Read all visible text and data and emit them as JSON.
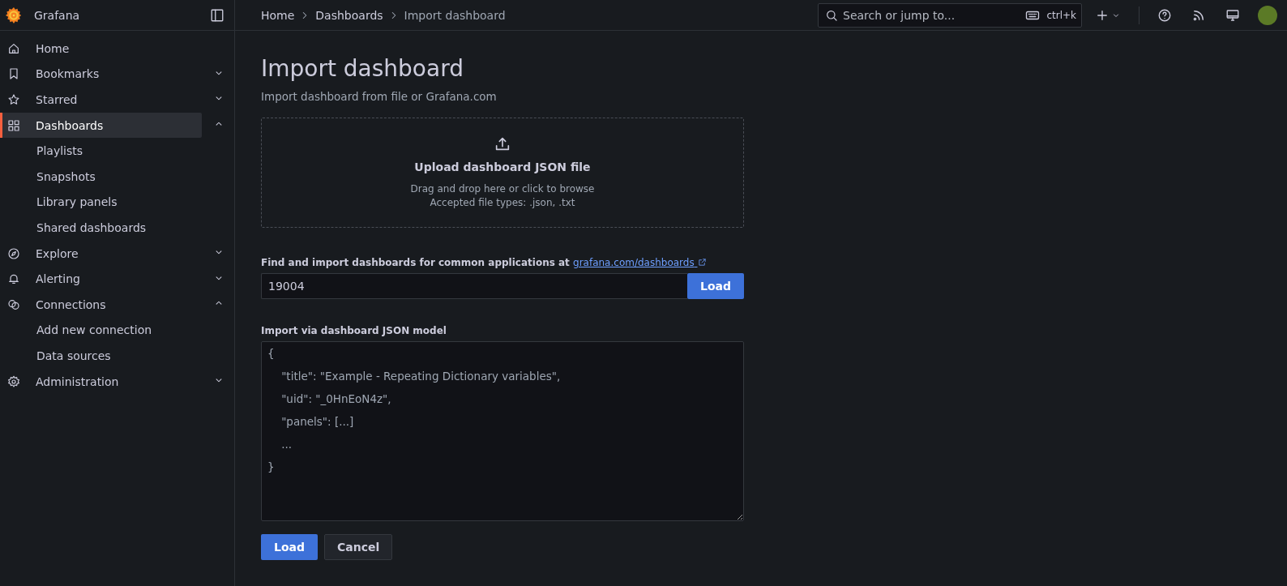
{
  "sidebar": {
    "brand": "Grafana",
    "items": [
      {
        "label": "Home",
        "selected": false
      },
      {
        "label": "Bookmarks",
        "selected": false,
        "expanded": false
      },
      {
        "label": "Starred",
        "selected": false,
        "expanded": false
      },
      {
        "label": "Dashboards",
        "selected": true,
        "expanded": true,
        "children": [
          {
            "label": "Playlists"
          },
          {
            "label": "Snapshots"
          },
          {
            "label": "Library panels"
          },
          {
            "label": "Shared dashboards"
          }
        ]
      },
      {
        "label": "Explore",
        "selected": false,
        "expanded": false
      },
      {
        "label": "Alerting",
        "selected": false,
        "expanded": false
      },
      {
        "label": "Connections",
        "selected": false,
        "expanded": true,
        "children": [
          {
            "label": "Add new connection"
          },
          {
            "label": "Data sources"
          }
        ]
      },
      {
        "label": "Administration",
        "selected": false,
        "expanded": false
      }
    ]
  },
  "topbar": {
    "breadcrumbs": [
      {
        "label": "Home",
        "selected": false
      },
      {
        "label": "Dashboards",
        "selected": false
      },
      {
        "label": "Import dashboard",
        "selected": true
      }
    ],
    "search": {
      "placeholder": "Search or jump to...",
      "shortcut": "ctrl+k"
    }
  },
  "page": {
    "title": "Import dashboard",
    "subtitle": "Import dashboard from file or Grafana.com",
    "upload": {
      "title": "Upload dashboard JSON file",
      "hint": "Drag and drop here or click to browse",
      "types": "Accepted file types: .json, .txt"
    },
    "find": {
      "label": "Find and import dashboards for common applications at",
      "link": "grafana.com/dashboards",
      "value": "19004",
      "button": "Load"
    },
    "json_model": {
      "label": "Import via dashboard JSON model",
      "placeholder": "{\n    \"title\": \"Example - Repeating Dictionary variables\",\n    \"uid\": \"_0HnEoN4z\",\n    \"panels\": [...]\n    ...\n}"
    },
    "buttons": [
      {
        "label": "Load",
        "kind": "primary"
      },
      {
        "label": "Cancel",
        "kind": "secondary"
      }
    ]
  }
}
